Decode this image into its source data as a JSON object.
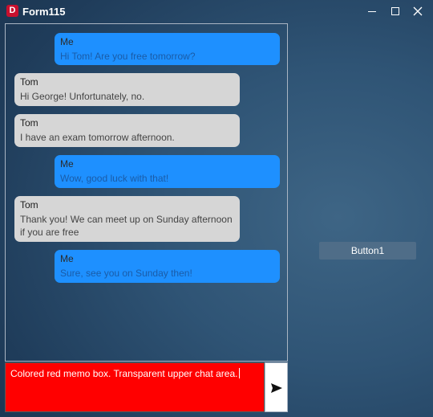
{
  "window": {
    "title": "Form115",
    "app_icon_letter": "D"
  },
  "chat": {
    "messages": [
      {
        "sender": "Me",
        "text": "Hi Tom! Are you free tomorrow?"
      },
      {
        "sender": "Tom",
        "text": "Hi George! Unfortunately, no."
      },
      {
        "sender": "Tom",
        "text": "I have an exam tomorrow afternoon."
      },
      {
        "sender": "Me",
        "text": "Wow, good luck with that!"
      },
      {
        "sender": "Tom",
        "text": "Thank you! We can meet up on Sunday afternoon if you are free"
      },
      {
        "sender": "Me",
        "text": "Sure, see you on Sunday then!"
      }
    ]
  },
  "button1": {
    "label": "Button1"
  },
  "memo": {
    "value": "Colored red memo box. Transparent upper chat area."
  },
  "send_button": {
    "icon": "send-icon"
  },
  "colors": {
    "my_bubble": "#1e90ff",
    "their_bubble": "#d6d6d6",
    "memo_background": "#ff0000"
  }
}
